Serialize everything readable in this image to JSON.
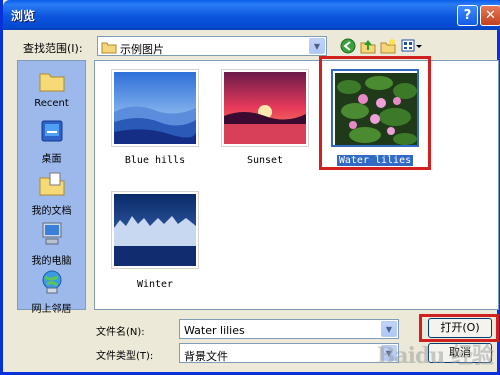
{
  "window": {
    "title": "浏览",
    "help_glyph": "?",
    "close_glyph": "✕"
  },
  "lookin": {
    "label": "查找范围(I):",
    "value": "示例图片"
  },
  "places": [
    {
      "label": "Recent",
      "icon": "recent-folder-icon"
    },
    {
      "label": "桌面",
      "icon": "desktop-icon"
    },
    {
      "label": "我的文档",
      "icon": "my-documents-icon"
    },
    {
      "label": "我的电脑",
      "icon": "my-computer-icon"
    },
    {
      "label": "网上邻居",
      "icon": "network-icon"
    }
  ],
  "files": [
    {
      "name": "Blue hills",
      "selected": false
    },
    {
      "name": "Sunset",
      "selected": false
    },
    {
      "name": "Water lilies",
      "selected": true
    },
    {
      "name": "Winter",
      "selected": false
    }
  ],
  "filename": {
    "label": "文件名(N):",
    "value": "Water lilies"
  },
  "filetype": {
    "label": "文件类型(T):",
    "value": "背景文件"
  },
  "buttons": {
    "open": "打开(O)",
    "cancel": "取消"
  },
  "watermark": "Baidu 经验",
  "colors": {
    "selection": "#316AC5",
    "highlight_outline": "#D02020",
    "titlebar": "#0B56DC"
  }
}
